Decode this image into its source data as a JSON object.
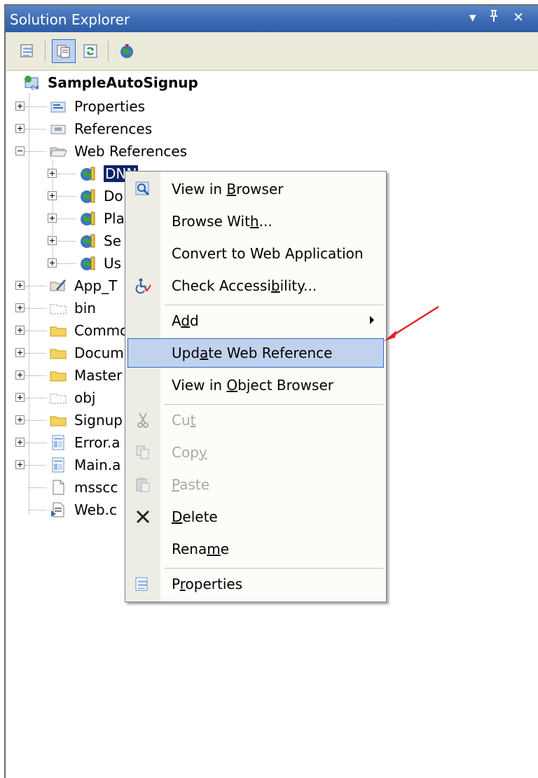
{
  "panel": {
    "title": "Solution Explorer",
    "controls": {
      "dropdown": "▾",
      "pin": "ᵖ",
      "close": "✕"
    }
  },
  "toolbar": {
    "buttons": [
      {
        "icon": "properties-icon"
      },
      {
        "icon": "show-all-files-icon"
      },
      {
        "icon": "refresh-icon"
      },
      {
        "icon": "copy-website-icon"
      }
    ]
  },
  "tree": {
    "project": "SampleAutoSignup",
    "items": [
      {
        "label": "Properties",
        "icon": "properties-folder-icon"
      },
      {
        "label": "References",
        "icon": "references-icon"
      },
      {
        "label": "Web References",
        "icon": "open-folder-icon"
      },
      {
        "label": "DNN",
        "icon": "web-reference-icon"
      },
      {
        "label": "Do",
        "icon": "web-reference-icon"
      },
      {
        "label": "Pla",
        "icon": "web-reference-icon"
      },
      {
        "label": "Se",
        "icon": "web-reference-icon"
      },
      {
        "label": "Us",
        "icon": "web-reference-icon"
      },
      {
        "label": "App_T",
        "icon": "app-themes-icon"
      },
      {
        "label": "bin",
        "icon": "dashed-folder-icon"
      },
      {
        "label": "Commo",
        "icon": "folder-icon"
      },
      {
        "label": "Docum",
        "icon": "folder-icon"
      },
      {
        "label": "Master",
        "icon": "folder-icon"
      },
      {
        "label": "obj",
        "icon": "dashed-folder-icon"
      },
      {
        "label": "Signup",
        "icon": "folder-icon"
      },
      {
        "label": "Error.a",
        "icon": "aspx-file-icon"
      },
      {
        "label": "Main.a",
        "icon": "aspx-file-icon"
      },
      {
        "label": "msscc",
        "icon": "file-icon"
      },
      {
        "label": "Web.c",
        "icon": "config-file-icon"
      }
    ]
  },
  "context_menu": {
    "items": [
      {
        "pre": "View in ",
        "ul": "B",
        "post": "rowser",
        "icon": "view-browser-icon"
      },
      {
        "pre": "Browse Wit",
        "ul": "h",
        "post": "...",
        "icon": ""
      },
      {
        "pre": "Convert to Web Application",
        "ul": "",
        "post": "",
        "icon": ""
      },
      {
        "pre": "Check Accessi",
        "ul": "b",
        "post": "ility...",
        "icon": "accessibility-icon"
      },
      {
        "pre": "A",
        "ul": "d",
        "post": "d",
        "icon": ""
      },
      {
        "pre": "Upd",
        "ul": "a",
        "post": "te Web Reference",
        "icon": ""
      },
      {
        "pre": "View in ",
        "ul": "O",
        "post": "bject Browser",
        "icon": ""
      },
      {
        "pre": "Cu",
        "ul": "t",
        "post": "",
        "icon": "scissors-icon"
      },
      {
        "pre": "Cop",
        "ul": "y",
        "post": "",
        "icon": "copy-icon"
      },
      {
        "pre": "",
        "ul": "P",
        "post": "aste",
        "icon": "paste-icon"
      },
      {
        "pre": "",
        "ul": "D",
        "post": "elete",
        "icon": "delete-x-icon"
      },
      {
        "pre": "Rena",
        "ul": "m",
        "post": "e",
        "icon": ""
      },
      {
        "pre": "P",
        "ul": "r",
        "post": "operties",
        "icon": "properties-menu-icon"
      }
    ]
  },
  "colors": {
    "title_bar": "#3c6bb4",
    "selection": "#0a246a",
    "menu_highlight": "#c1d2ee",
    "annotation_arrow": "#e02020"
  }
}
